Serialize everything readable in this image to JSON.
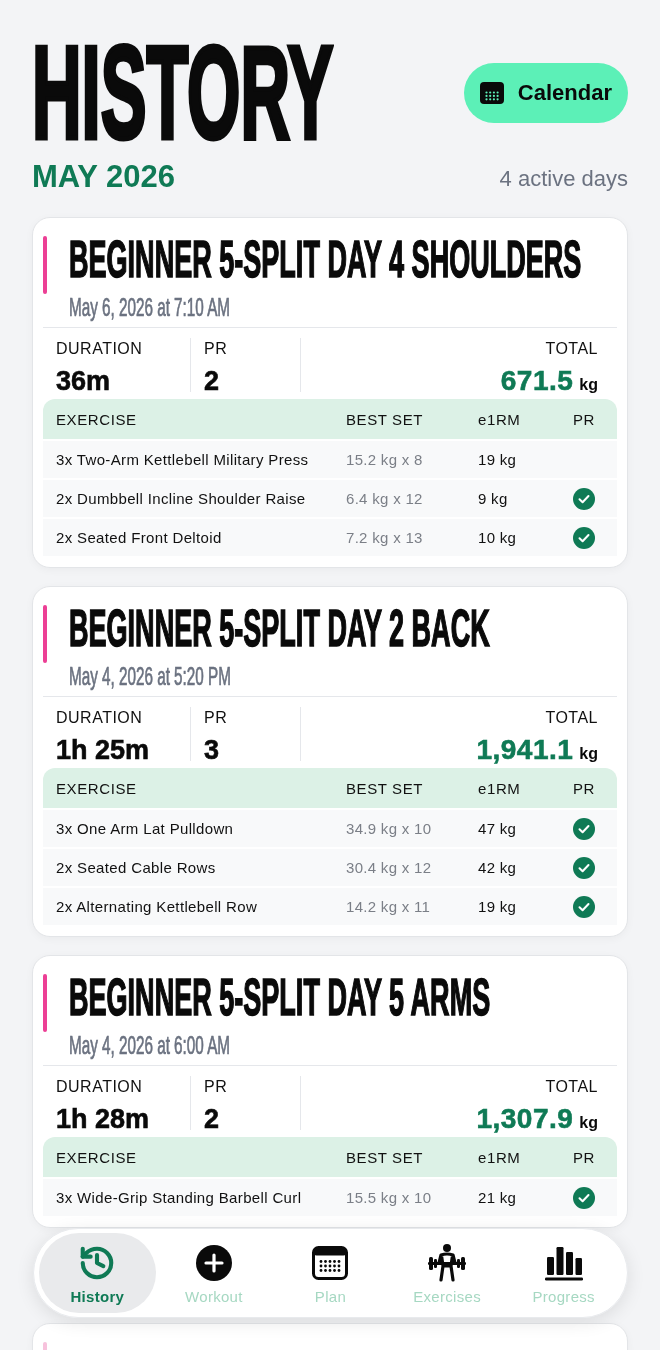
{
  "header": {
    "title": "HISTORY",
    "calendar_button": "Calendar",
    "month": "MAY 2026",
    "active_days": "4 active days"
  },
  "workouts": [
    {
      "title": "BEGINNER 5-SPLIT DAY 4 SHOULDERS",
      "date": "May 6, 2026 at 7:10 AM",
      "dimmed": false,
      "stats": [
        {
          "kind": "duration",
          "label": "DURATION",
          "value": "36m"
        },
        {
          "kind": "pr",
          "label": "PR",
          "value": "2"
        },
        {
          "kind": "total",
          "label": "TOTAL",
          "value": "671.5",
          "unit": "kg"
        }
      ],
      "table": {
        "columns": [
          "EXERCISE",
          "BEST SET",
          "e1RM",
          "PR"
        ],
        "rows": [
          {
            "exercise": "3x Two-Arm Kettlebell Military Press",
            "best_set": "15.2 kg x 8",
            "e1rm": "19 kg",
            "pr": false
          },
          {
            "exercise": "2x Dumbbell Incline Shoulder Raise",
            "best_set": "6.4 kg x 12",
            "e1rm": "9 kg",
            "pr": true
          },
          {
            "exercise": "2x Seated Front Deltoid",
            "best_set": "7.2 kg x 13",
            "e1rm": "10 kg",
            "pr": true
          }
        ]
      }
    },
    {
      "title": "BEGINNER 5-SPLIT DAY 2 BACK",
      "date": "May 4, 2026 at 5:20 PM",
      "dimmed": false,
      "stats": [
        {
          "kind": "duration",
          "label": "DURATION",
          "value": "1h 25m"
        },
        {
          "kind": "pr",
          "label": "PR",
          "value": "3"
        },
        {
          "kind": "total",
          "label": "TOTAL",
          "value": "1,941.1",
          "unit": "kg"
        }
      ],
      "table": {
        "columns": [
          "EXERCISE",
          "BEST SET",
          "e1RM",
          "PR"
        ],
        "rows": [
          {
            "exercise": "3x One Arm Lat Pulldown",
            "best_set": "34.9 kg x 10",
            "e1rm": "47 kg",
            "pr": true
          },
          {
            "exercise": "2x Seated Cable Rows",
            "best_set": "30.4 kg x 12",
            "e1rm": "42 kg",
            "pr": true
          },
          {
            "exercise": "2x Alternating Kettlebell Row",
            "best_set": "14.2 kg x 11",
            "e1rm": "19 kg",
            "pr": true
          }
        ]
      }
    },
    {
      "title": "BEGINNER 5-SPLIT DAY 5 ARMS",
      "date": "May 4, 2026 at 6:00 AM",
      "dimmed": false,
      "stats": [
        {
          "kind": "duration",
          "label": "DURATION",
          "value": "1h 28m"
        },
        {
          "kind": "pr",
          "label": "PR",
          "value": "2"
        },
        {
          "kind": "total",
          "label": "TOTAL",
          "value": "1,307.9",
          "unit": "kg"
        }
      ],
      "table": {
        "columns": [
          "EXERCISE",
          "BEST SET",
          "e1RM",
          "PR"
        ],
        "rows": [
          {
            "exercise": "3x Wide-Grip Standing Barbell Curl",
            "best_set": "15.5 kg x 10",
            "e1rm": "21 kg",
            "pr": true
          }
        ]
      }
    },
    {
      "dimmed": true
    }
  ],
  "tab_bar": [
    {
      "label": "History",
      "selected": true
    },
    {
      "label": "Workout",
      "selected": false
    },
    {
      "label": "Plan",
      "selected": false
    },
    {
      "label": "Exercises",
      "selected": false
    },
    {
      "label": "Progress",
      "selected": false
    }
  ]
}
